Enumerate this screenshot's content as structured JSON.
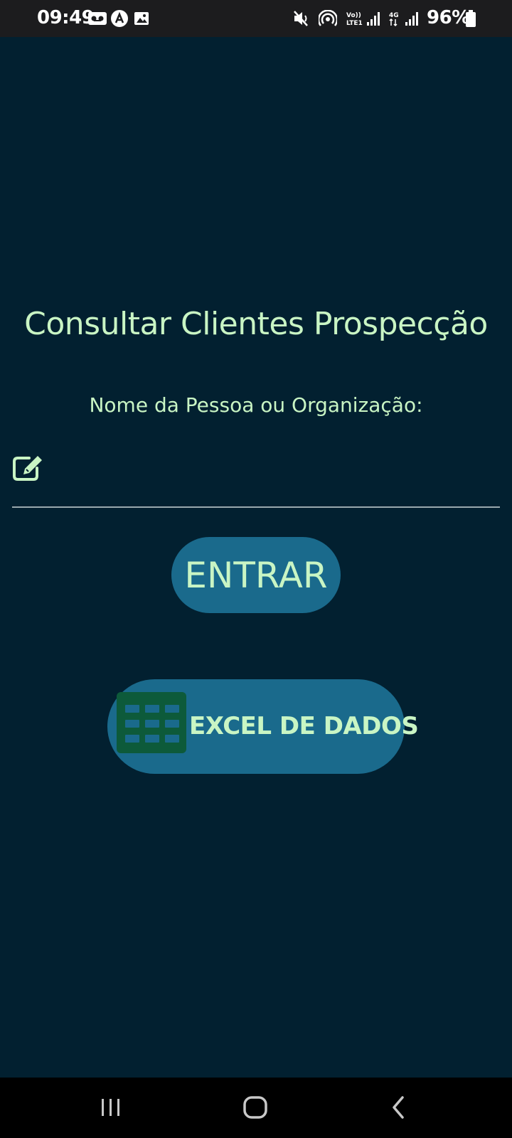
{
  "status_bar": {
    "time": "09:49",
    "battery": "96%",
    "icons": [
      "voicemail-icon",
      "app-notification-icon",
      "gallery-icon",
      "mute-icon",
      "hotspot-icon",
      "volte-icon",
      "signal-icon",
      "4g-icon",
      "signal-icon",
      "battery-icon"
    ]
  },
  "page": {
    "title": "Consultar Clientes Prospecção",
    "field_label": "Nome da Pessoa ou Organização:",
    "name_input": {
      "value": "",
      "placeholder": "",
      "icon": "edit-icon"
    },
    "enter_button": "ENTRAR",
    "excel_button": {
      "label": "EXCEL DE DADOS",
      "icon": "spreadsheet-icon"
    }
  },
  "nav_bar": {
    "items": [
      "recent-apps-icon",
      "home-icon",
      "back-icon"
    ]
  },
  "colors": {
    "background": "#022030",
    "text": "#c9f5c4",
    "button": "#1a6a8c",
    "excel_icon": "#0d5a3a"
  }
}
